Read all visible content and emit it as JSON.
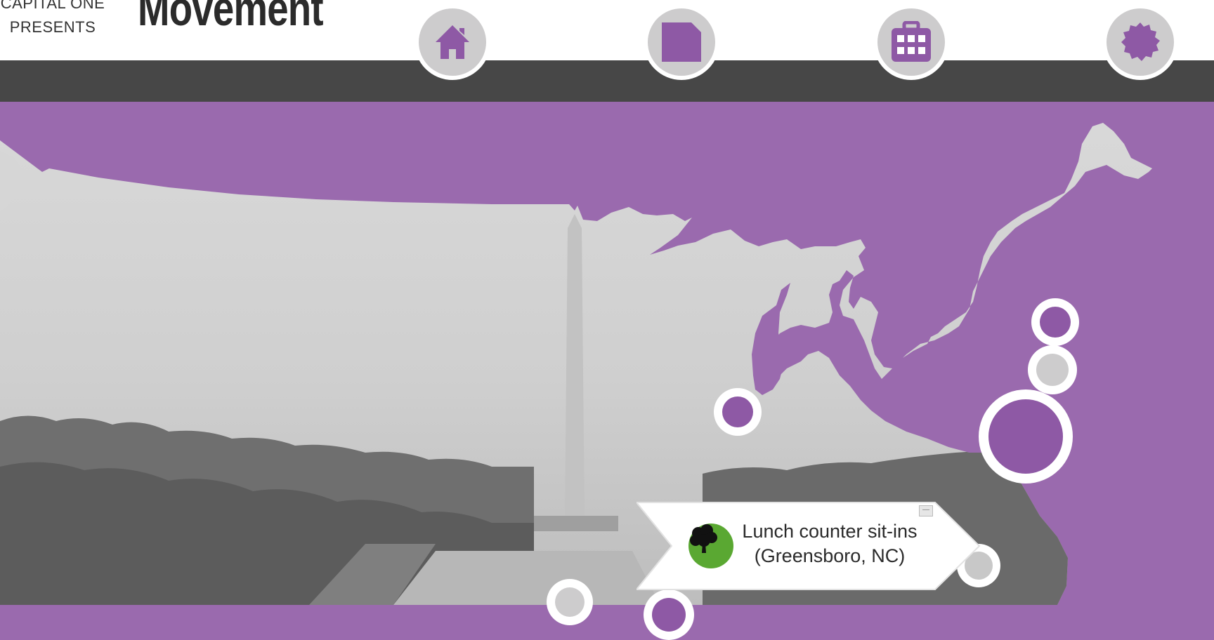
{
  "header": {
    "brand_line1": "CAPITAL ONE",
    "brand_line2": "PRESENTS",
    "title": "Movement"
  },
  "nav": {
    "items": [
      {
        "icon": "home-icon"
      },
      {
        "icon": "square-icon"
      },
      {
        "icon": "grid-icon"
      },
      {
        "icon": "badge-icon"
      }
    ]
  },
  "tooltip": {
    "line1": "Lunch counter sit-ins",
    "line2": "(Greensboro, NC)",
    "icon": "tree-icon",
    "close_label": "—"
  },
  "colors": {
    "accent": "#9a6aae",
    "marker_purple": "#8e59a5",
    "nav_bar": "#474747",
    "land": "#d6d6d6",
    "tree_badge": "#5aa832"
  }
}
